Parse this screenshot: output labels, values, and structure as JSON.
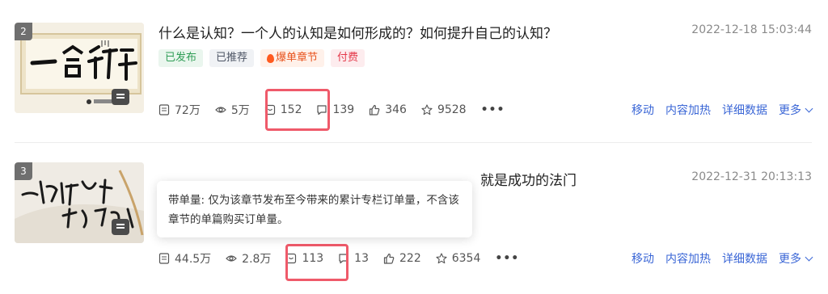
{
  "articles": [
    {
      "index": "2",
      "title": "什么是认知？一个人的认知是如何形成的？如何提升自己的认知？",
      "date": "2022-12-18 15:03:44",
      "tags": [
        "已发布",
        "已推荐",
        "爆单章节",
        "付费"
      ],
      "stats": {
        "views": "72万",
        "reads": "5万",
        "orders": "152",
        "comments": "139",
        "likes": "346",
        "favorites": "9528"
      }
    },
    {
      "index": "3",
      "title_visible_end": "就是成功的法门",
      "date": "2022-12-31 20:13:13",
      "stats": {
        "views": "44.5万",
        "reads": "2.8万",
        "orders": "113",
        "comments": "13",
        "likes": "222",
        "favorites": "6354"
      }
    }
  ],
  "actions": {
    "move": "移动",
    "boost": "内容加热",
    "details": "详细数据",
    "more": "更多"
  },
  "more_dots": "•••",
  "tooltip": {
    "text": "带单量: 仅为该章节发布至今带来的累计专栏订单量，不含该章节的单篇购买订单量。"
  },
  "colors": {
    "link": "#3a66d6",
    "highlight": "#ef5a6a",
    "tag_green": "#2e9d55",
    "tag_orange": "#e8541e",
    "tag_red": "#e4394a"
  },
  "icons": [
    "doc-icon",
    "eye-icon",
    "order-icon",
    "comment-icon",
    "like-icon",
    "star-icon",
    "chevron-down-icon",
    "flame-icon"
  ]
}
